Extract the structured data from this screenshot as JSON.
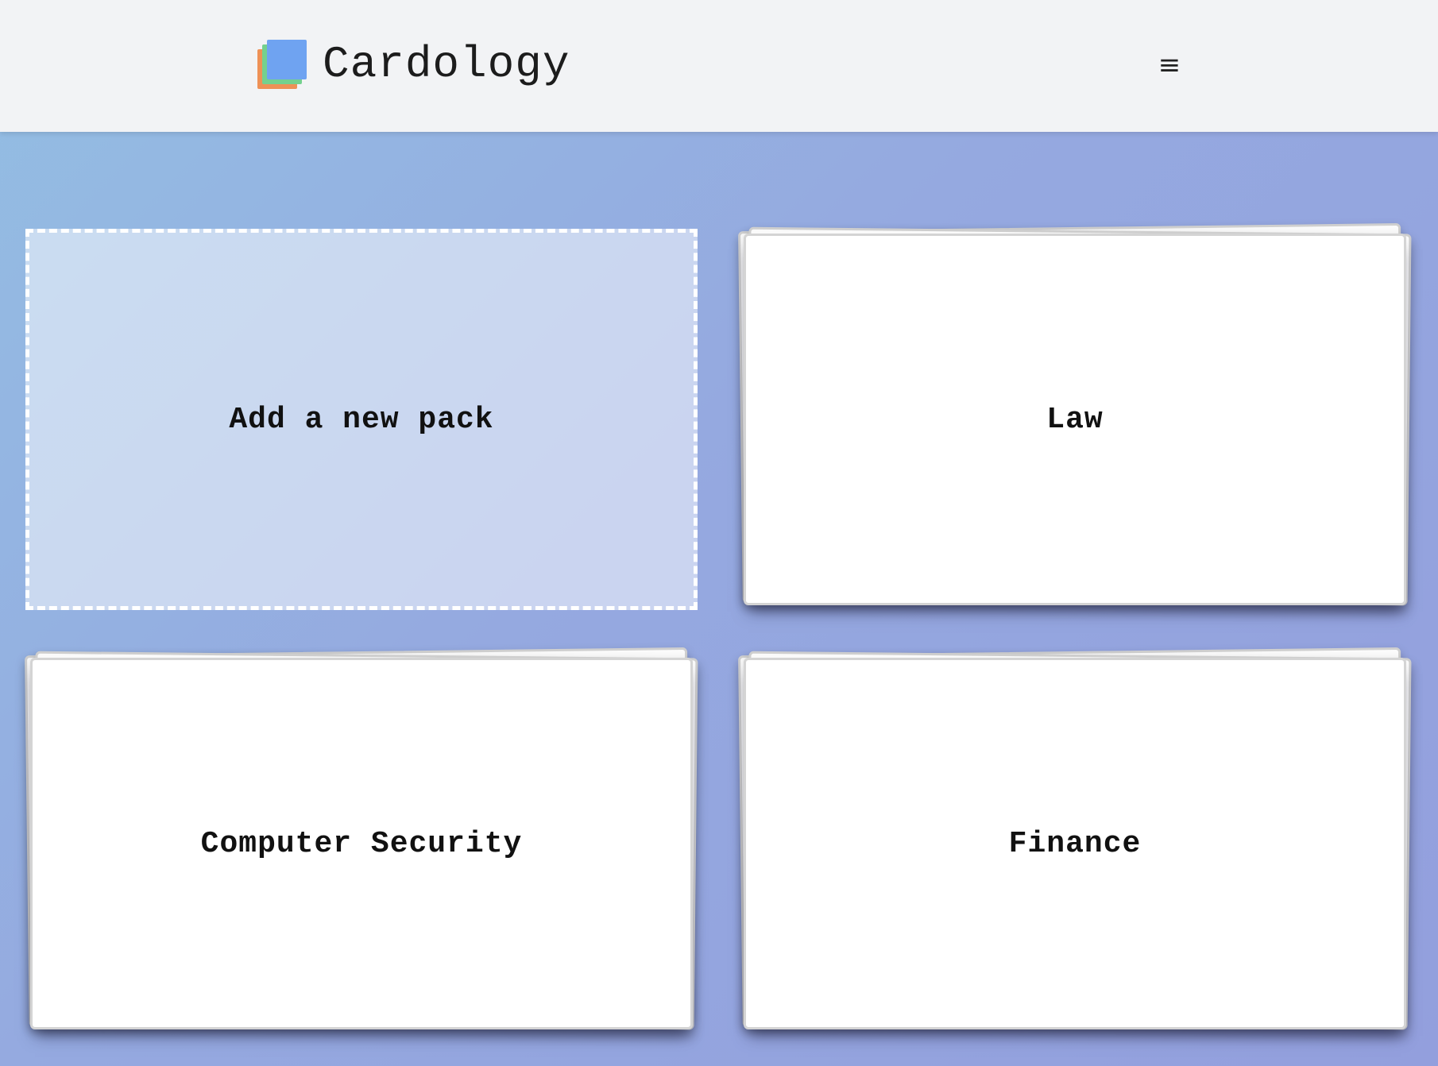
{
  "header": {
    "brand_name": "Cardology",
    "logo_icon": "stacked-cards-logo",
    "menu_icon_glyph": "≡"
  },
  "packs": {
    "add_new_label": "Add a new pack",
    "items": [
      {
        "title": "Law"
      },
      {
        "title": "Computer Security"
      },
      {
        "title": "Finance"
      }
    ]
  },
  "colors": {
    "header_bg": "#f2f3f5",
    "background_start": "#93bee3",
    "background_end": "#939fdd",
    "logo_orange": "#ee9156",
    "logo_green": "#74d18e",
    "logo_blue": "#6fa3f1"
  }
}
